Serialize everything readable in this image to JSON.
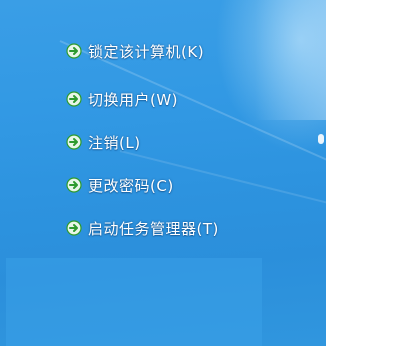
{
  "menu": {
    "items": [
      {
        "label": "锁定该计算机(K)",
        "icon": "green-arrow-icon"
      },
      {
        "label": "切换用户(W)",
        "icon": "green-arrow-icon"
      },
      {
        "label": "注销(L)",
        "icon": "green-arrow-icon"
      },
      {
        "label": "更改密码(C)",
        "icon": "green-arrow-icon"
      },
      {
        "label": "启动任务管理器(T)",
        "icon": "green-arrow-icon"
      }
    ]
  },
  "colors": {
    "background": "#3299e4",
    "text": "#ffffff",
    "arrow": "#2e9a2e"
  }
}
